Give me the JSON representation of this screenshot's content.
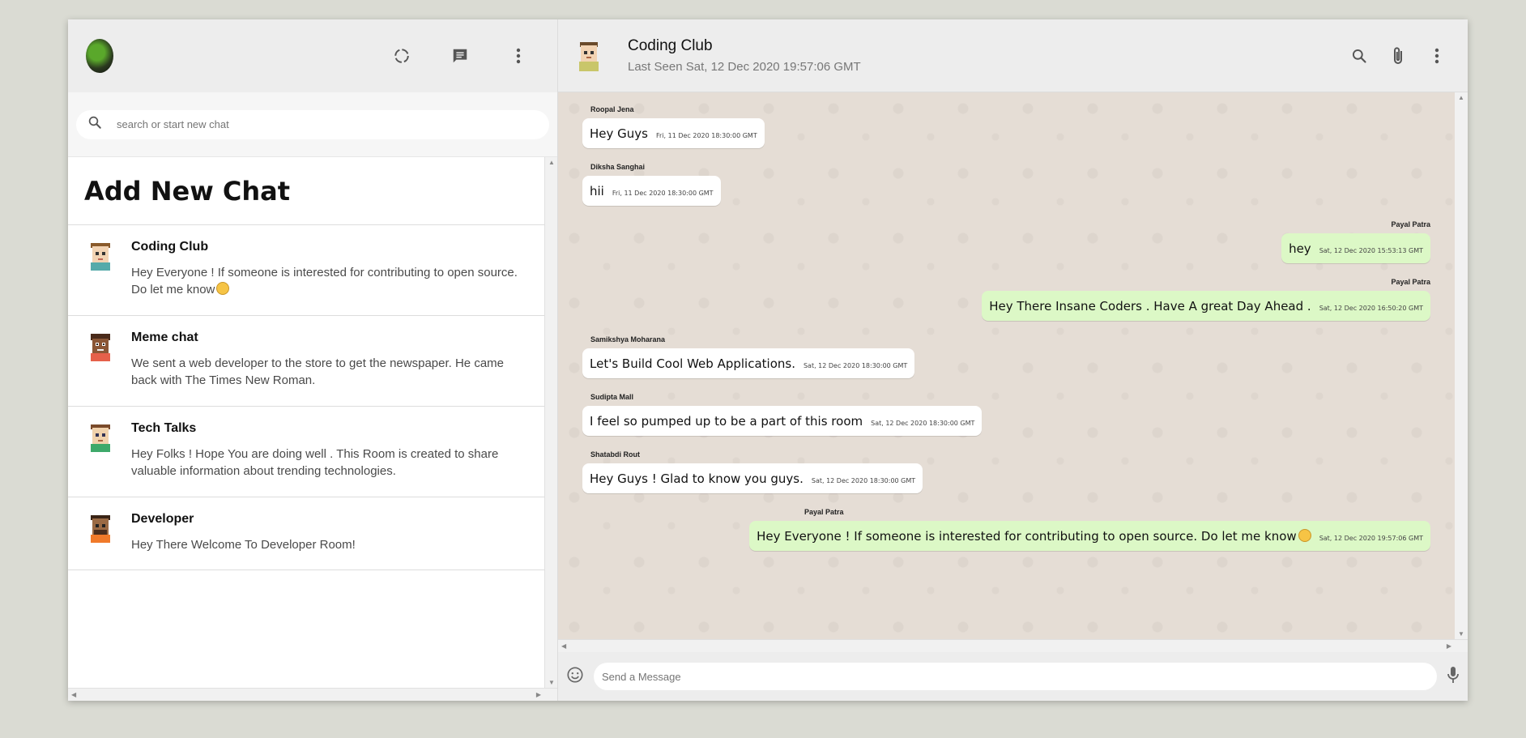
{
  "sidebar": {
    "search": {
      "placeholder": "search or start new chat"
    },
    "add_new_chat": "Add New Chat",
    "chats": [
      {
        "name": "Coding Club",
        "last_message": "Hey Everyone ! If someone is interested for contributing to open source. Do let me know",
        "emoji": "hugging-face"
      },
      {
        "name": "Meme chat",
        "last_message": "We sent a web developer to the store to get the newspaper. He came back with The Times New Roman."
      },
      {
        "name": "Tech Talks",
        "last_message": "Hey Folks ! Hope You are doing well . This Room is created to share valuable information about trending technologies."
      },
      {
        "name": "Developer",
        "last_message": "Hey There Welcome To Developer Room!"
      }
    ]
  },
  "chat_header": {
    "title": "Coding Club",
    "status": "Last Seen Sat, 12 Dec 2020 19:57:06 GMT"
  },
  "messages": [
    {
      "sender": "Roopal Jena",
      "text": "Hey Guys",
      "time": "Fri, 11 Dec 2020 18:30:00 GMT",
      "outgoing": false
    },
    {
      "sender": "Diksha Sanghai",
      "text": "hii",
      "time": "Fri, 11 Dec 2020 18:30:00 GMT",
      "outgoing": false
    },
    {
      "sender": "Payal Patra",
      "text": "hey",
      "time": "Sat, 12 Dec 2020 15:53:13 GMT",
      "outgoing": true
    },
    {
      "sender": "Payal Patra",
      "text": "Hey There Insane Coders . Have A great Day Ahead .",
      "time": "Sat, 12 Dec 2020 16:50:20 GMT",
      "outgoing": true
    },
    {
      "sender": "Samikshya Moharana",
      "text": "Let's Build Cool Web Applications.",
      "time": "Sat, 12 Dec 2020 18:30:00 GMT",
      "outgoing": false
    },
    {
      "sender": "Sudipta Mall",
      "text": "I feel so pumped up to be a part of this room",
      "time": "Sat, 12 Dec 2020 18:30:00 GMT",
      "outgoing": false
    },
    {
      "sender": "Shatabdi Rout",
      "text": "Hey Guys ! Glad to know you guys.",
      "time": "Sat, 12 Dec 2020 18:30:00 GMT",
      "outgoing": false
    },
    {
      "sender": "Payal Patra",
      "text": "Hey Everyone ! If someone is interested for contributing to open source. Do let me know",
      "time": "Sat, 12 Dec 2020 19:57:06 GMT",
      "outgoing": true,
      "emoji": "hugging-face"
    }
  ],
  "composer": {
    "placeholder": "Send a Message"
  },
  "colors": {
    "outgoing_bubble": "#dcf8c6",
    "incoming_bubble": "#ffffff",
    "chat_background": "#e5ddd5",
    "header": "#ededed"
  }
}
